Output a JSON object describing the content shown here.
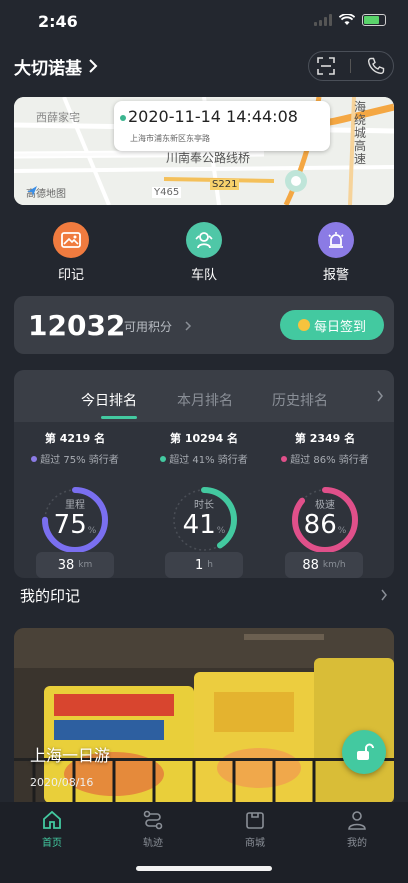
{
  "status": {
    "time": "2:46"
  },
  "header": {
    "title": "大切诺基"
  },
  "map": {
    "datetime": "2020-11-14 14:44:08",
    "address": "上海市浦东新区东亭路",
    "labels": [
      "西薛家宅",
      "川南奉公路线桥",
      "Y465",
      "S221",
      "海绕城高速"
    ],
    "provider": "高德地图"
  },
  "quick_actions": [
    {
      "label": "印记",
      "icon": "photo-icon",
      "color": "#f07b3f"
    },
    {
      "label": "车队",
      "icon": "team-icon",
      "color": "#4fc7a7"
    },
    {
      "label": "报警",
      "icon": "alarm-icon",
      "color": "#8b7be5"
    }
  ],
  "points": {
    "value": "12032",
    "label": "可用积分",
    "checkin": "每日签到"
  },
  "ranking": {
    "tabs": [
      "今日排名",
      "本月排名",
      "历史排名"
    ],
    "active_tab": 0,
    "columns": [
      {
        "place": "第 4219 名",
        "beat": "超过 75% 骑行者",
        "dot_color": "#8b7be5",
        "caption": "里程",
        "value": "75",
        "unit": "%",
        "fraction": 0.75,
        "color": "#7a6ff0",
        "pill_value": "38",
        "pill_unit": "km"
      },
      {
        "place": "第 10294 名",
        "beat": "超过 41% 骑行者",
        "dot_color": "#43c9a0",
        "caption": "时长",
        "value": "41",
        "unit": "%",
        "fraction": 0.41,
        "color": "#43c9a0",
        "pill_value": "1",
        "pill_unit": "h"
      },
      {
        "place": "第 2349 名",
        "beat": "超过 86% 骑行者",
        "dot_color": "#e0508a",
        "caption": "极速",
        "value": "86",
        "unit": "%",
        "fraction": 0.86,
        "color": "#e0508a",
        "pill_value": "88",
        "pill_unit": "km/h"
      }
    ]
  },
  "marks": {
    "title": "我的印记",
    "card": {
      "title": "上海一日游",
      "date": "2020/08/16"
    }
  },
  "tabbar": {
    "items": [
      {
        "label": "首页",
        "icon": "home-icon",
        "active": true
      },
      {
        "label": "轨迹",
        "icon": "route-icon",
        "active": false
      },
      {
        "label": "商城",
        "icon": "shop-icon",
        "active": false
      },
      {
        "label": "我的",
        "icon": "user-icon",
        "active": false
      }
    ]
  }
}
